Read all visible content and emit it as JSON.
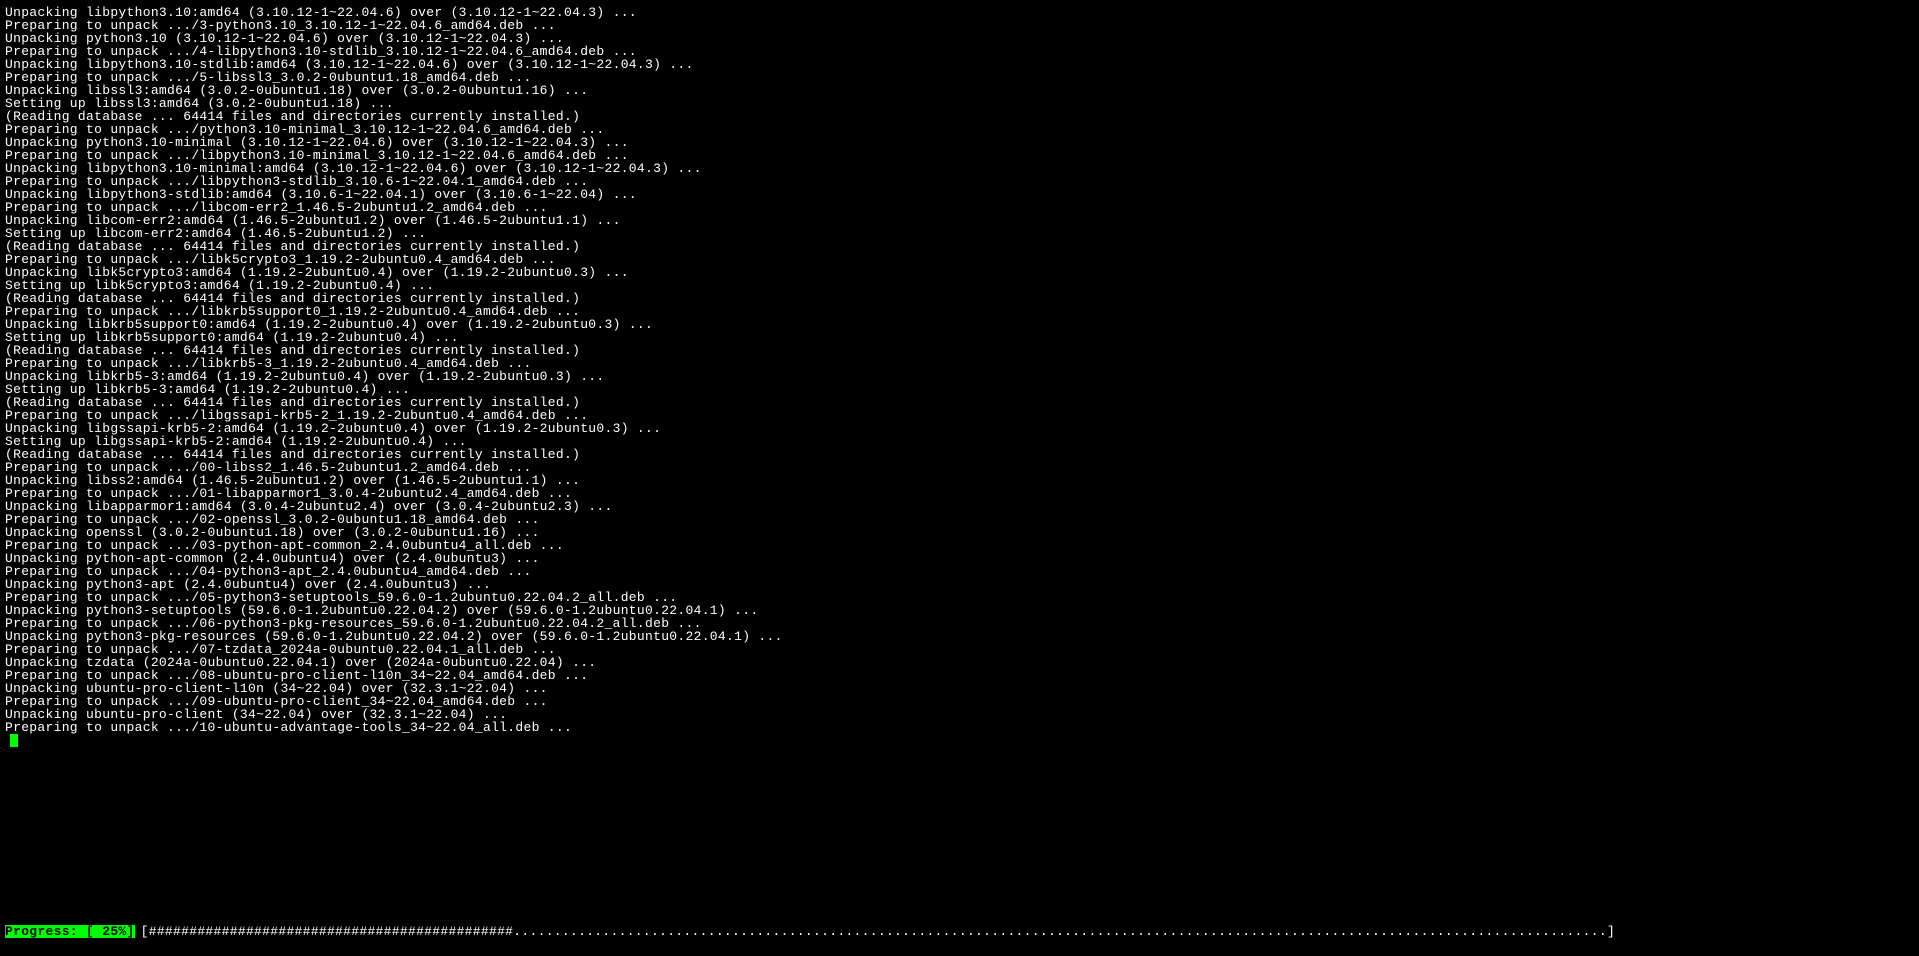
{
  "terminal": {
    "lines": [
      "Unpacking libpython3.10:amd64 (3.10.12-1~22.04.6) over (3.10.12-1~22.04.3) ...",
      "Preparing to unpack .../3-python3.10_3.10.12-1~22.04.6_amd64.deb ...",
      "Unpacking python3.10 (3.10.12-1~22.04.6) over (3.10.12-1~22.04.3) ...",
      "Preparing to unpack .../4-libpython3.10-stdlib_3.10.12-1~22.04.6_amd64.deb ...",
      "Unpacking libpython3.10-stdlib:amd64 (3.10.12-1~22.04.6) over (3.10.12-1~22.04.3) ...",
      "Preparing to unpack .../5-libssl3_3.0.2-0ubuntu1.18_amd64.deb ...",
      "Unpacking libssl3:amd64 (3.0.2-0ubuntu1.18) over (3.0.2-0ubuntu1.16) ...",
      "Setting up libssl3:amd64 (3.0.2-0ubuntu1.18) ...",
      "(Reading database ... 64414 files and directories currently installed.)",
      "Preparing to unpack .../python3.10-minimal_3.10.12-1~22.04.6_amd64.deb ...",
      "Unpacking python3.10-minimal (3.10.12-1~22.04.6) over (3.10.12-1~22.04.3) ...",
      "Preparing to unpack .../libpython3.10-minimal_3.10.12-1~22.04.6_amd64.deb ...",
      "Unpacking libpython3.10-minimal:amd64 (3.10.12-1~22.04.6) over (3.10.12-1~22.04.3) ...",
      "Preparing to unpack .../libpython3-stdlib_3.10.6-1~22.04.1_amd64.deb ...",
      "Unpacking libpython3-stdlib:amd64 (3.10.6-1~22.04.1) over (3.10.6-1~22.04) ...",
      "Preparing to unpack .../libcom-err2_1.46.5-2ubuntu1.2_amd64.deb ...",
      "Unpacking libcom-err2:amd64 (1.46.5-2ubuntu1.2) over (1.46.5-2ubuntu1.1) ...",
      "Setting up libcom-err2:amd64 (1.46.5-2ubuntu1.2) ...",
      "(Reading database ... 64414 files and directories currently installed.)",
      "Preparing to unpack .../libk5crypto3_1.19.2-2ubuntu0.4_amd64.deb ...",
      "Unpacking libk5crypto3:amd64 (1.19.2-2ubuntu0.4) over (1.19.2-2ubuntu0.3) ...",
      "Setting up libk5crypto3:amd64 (1.19.2-2ubuntu0.4) ...",
      "(Reading database ... 64414 files and directories currently installed.)",
      "Preparing to unpack .../libkrb5support0_1.19.2-2ubuntu0.4_amd64.deb ...",
      "Unpacking libkrb5support0:amd64 (1.19.2-2ubuntu0.4) over (1.19.2-2ubuntu0.3) ...",
      "Setting up libkrb5support0:amd64 (1.19.2-2ubuntu0.4) ...",
      "(Reading database ... 64414 files and directories currently installed.)",
      "Preparing to unpack .../libkrb5-3_1.19.2-2ubuntu0.4_amd64.deb ...",
      "Unpacking libkrb5-3:amd64 (1.19.2-2ubuntu0.4) over (1.19.2-2ubuntu0.3) ...",
      "Setting up libkrb5-3:amd64 (1.19.2-2ubuntu0.4) ...",
      "(Reading database ... 64414 files and directories currently installed.)",
      "Preparing to unpack .../libgssapi-krb5-2_1.19.2-2ubuntu0.4_amd64.deb ...",
      "Unpacking libgssapi-krb5-2:amd64 (1.19.2-2ubuntu0.4) over (1.19.2-2ubuntu0.3) ...",
      "Setting up libgssapi-krb5-2:amd64 (1.19.2-2ubuntu0.4) ...",
      "(Reading database ... 64414 files and directories currently installed.)",
      "Preparing to unpack .../00-libss2_1.46.5-2ubuntu1.2_amd64.deb ...",
      "Unpacking libss2:amd64 (1.46.5-2ubuntu1.2) over (1.46.5-2ubuntu1.1) ...",
      "Preparing to unpack .../01-libapparmor1_3.0.4-2ubuntu2.4_amd64.deb ...",
      "Unpacking libapparmor1:amd64 (3.0.4-2ubuntu2.4) over (3.0.4-2ubuntu2.3) ...",
      "Preparing to unpack .../02-openssl_3.0.2-0ubuntu1.18_amd64.deb ...",
      "Unpacking openssl (3.0.2-0ubuntu1.18) over (3.0.2-0ubuntu1.16) ...",
      "Preparing to unpack .../03-python-apt-common_2.4.0ubuntu4_all.deb ...",
      "Unpacking python-apt-common (2.4.0ubuntu4) over (2.4.0ubuntu3) ...",
      "Preparing to unpack .../04-python3-apt_2.4.0ubuntu4_amd64.deb ...",
      "Unpacking python3-apt (2.4.0ubuntu4) over (2.4.0ubuntu3) ...",
      "Preparing to unpack .../05-python3-setuptools_59.6.0-1.2ubuntu0.22.04.2_all.deb ...",
      "Unpacking python3-setuptools (59.6.0-1.2ubuntu0.22.04.2) over (59.6.0-1.2ubuntu0.22.04.1) ...",
      "Preparing to unpack .../06-python3-pkg-resources_59.6.0-1.2ubuntu0.22.04.2_all.deb ...",
      "Unpacking python3-pkg-resources (59.6.0-1.2ubuntu0.22.04.2) over (59.6.0-1.2ubuntu0.22.04.1) ...",
      "Preparing to unpack .../07-tzdata_2024a-0ubuntu0.22.04.1_all.deb ...",
      "Unpacking tzdata (2024a-0ubuntu0.22.04.1) over (2024a-0ubuntu0.22.04) ...",
      "Preparing to unpack .../08-ubuntu-pro-client-l10n_34~22.04_amd64.deb ...",
      "Unpacking ubuntu-pro-client-l10n (34~22.04) over (32.3.1~22.04) ...",
      "Preparing to unpack .../09-ubuntu-pro-client_34~22.04_amd64.deb ...",
      "Unpacking ubuntu-pro-client (34~22.04) over (32.3.1~22.04) ...",
      "Preparing to unpack .../10-ubuntu-advantage-tools_34~22.04_all.deb ..."
    ]
  },
  "progress": {
    "label": "Progress: [ 25%]",
    "percent": 25,
    "bar_total_chars": 180,
    "bar_fill_chars": 45
  }
}
